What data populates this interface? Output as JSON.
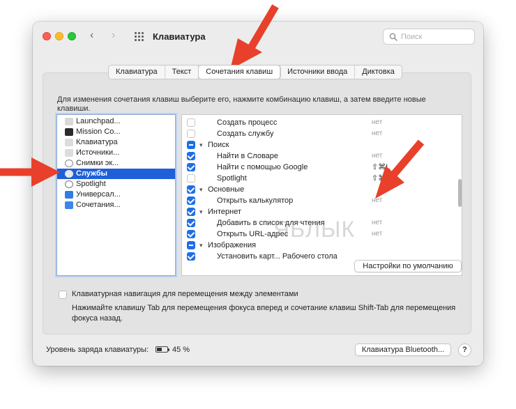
{
  "window": {
    "title": "Клавиатура",
    "nav_back": "‹",
    "nav_forward": "›",
    "search_placeholder": "Поиск"
  },
  "tabs": [
    {
      "label": "Клавиатура",
      "active": false
    },
    {
      "label": "Текст",
      "active": false
    },
    {
      "label": "Сочетания клавиш",
      "active": true
    },
    {
      "label": "Источники ввода",
      "active": false
    },
    {
      "label": "Диктовка",
      "active": false
    }
  ],
  "instructions": "Для изменения сочетания клавиш выберите его, нажмите комбинацию клавиш, а затем введите новые клавиши.",
  "categories": [
    {
      "label": "Launchpad...",
      "icon": "launchpad-icon",
      "selected": false
    },
    {
      "label": "Mission Co...",
      "icon": "mission-control-icon",
      "selected": false
    },
    {
      "label": "Клавиатура",
      "icon": "keyboard-icon",
      "selected": false
    },
    {
      "label": "Источники...",
      "icon": "input-sources-icon",
      "selected": false
    },
    {
      "label": "Снимки эк...",
      "icon": "screenshot-icon",
      "selected": false
    },
    {
      "label": "Службы",
      "icon": "gear-icon",
      "selected": true
    },
    {
      "label": "Spotlight",
      "icon": "spotlight-icon",
      "selected": false
    },
    {
      "label": "Универсал...",
      "icon": "accessibility-icon",
      "selected": false
    },
    {
      "label": "Сочетания...",
      "icon": "app-shortcuts-icon",
      "selected": false
    }
  ],
  "shortcuts": [
    {
      "label": "Создать процесс",
      "shortcut": "нет",
      "state": "off",
      "group": false
    },
    {
      "label": "Создать службу",
      "shortcut": "нет",
      "state": "off",
      "group": false
    },
    {
      "label": "Поиск",
      "shortcut": "",
      "state": "mixed",
      "group": true
    },
    {
      "label": "Найти в Словаре",
      "shortcut": "нет",
      "state": "on",
      "group": false
    },
    {
      "label": "Найти с помощью Google",
      "shortcut": "⇧⌘L",
      "state": "on",
      "group": false
    },
    {
      "label": "Spotlight",
      "shortcut": "⇧⌘F",
      "state": "off",
      "group": false
    },
    {
      "label": "Основные",
      "shortcut": "",
      "state": "on",
      "group": true
    },
    {
      "label": "Открыть калькулятор",
      "shortcut": "нет",
      "state": "on",
      "group": false
    },
    {
      "label": "Интернет",
      "shortcut": "",
      "state": "on",
      "group": true
    },
    {
      "label": "Добавить в список для чтения",
      "shortcut": "нет",
      "state": "on",
      "group": false
    },
    {
      "label": "Открыть URL-адрес",
      "shortcut": "нет",
      "state": "on",
      "group": false
    },
    {
      "label": "Изображения",
      "shortcut": "",
      "state": "mixed",
      "group": true
    },
    {
      "label": "Установить карт... Рабочего стола",
      "shortcut": "",
      "state": "on",
      "group": false
    }
  ],
  "restore_defaults_label": "Настройки по умолчанию",
  "keyboard_navigation": {
    "label": "Клавиатурная навигация для перемещения между элементами",
    "description": "Нажимайте клавишу Tab для перемещения фокуса вперед и сочетание клавиш Shift-Tab для перемещения фокуса назад."
  },
  "battery": {
    "label": "Уровень заряда клавиатуры:",
    "percent": "45 %",
    "level": 0.45
  },
  "bluetooth_button_label": "Клавиатура Bluetooth...",
  "help_label": "?",
  "watermark": "ЯБЛЫК",
  "colors": {
    "accent": "#1f6fe5",
    "selection": "#1f5fd8",
    "annotation_arrow": "#e8402a"
  }
}
